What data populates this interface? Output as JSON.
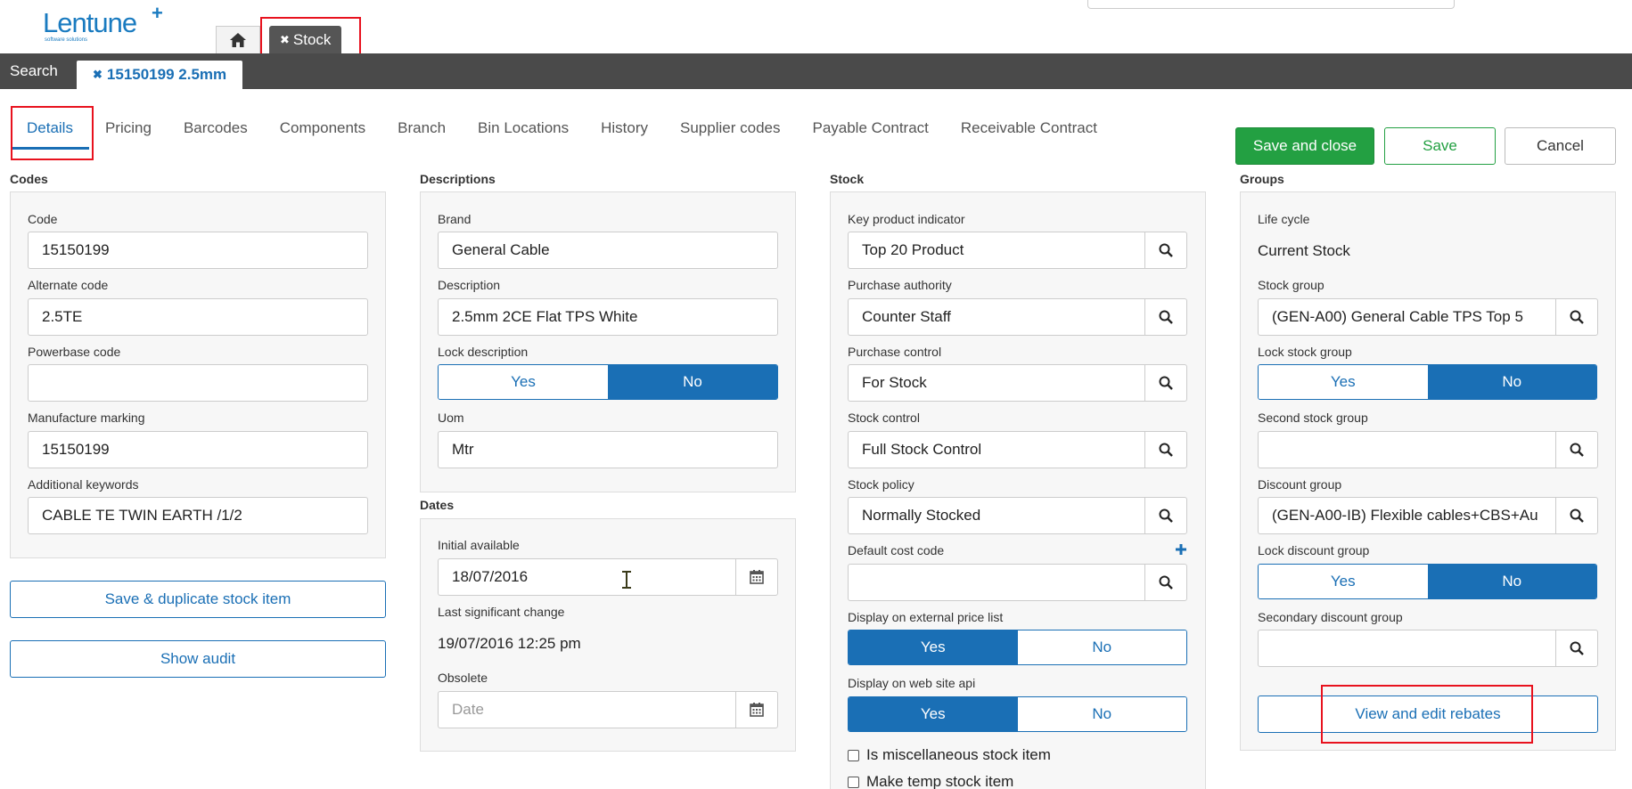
{
  "app": {
    "logo_text": "Lentune",
    "logo_plus": "+",
    "logo_tagline": "software solutions",
    "top_tab_stock": "Stock",
    "doc_bar_search": "Search",
    "doc_tab": "15150199 2.5mm",
    "close_glyph": "✖"
  },
  "tabs": [
    "Details",
    "Pricing",
    "Barcodes",
    "Components",
    "Branch",
    "Bin Locations",
    "History",
    "Supplier codes",
    "Payable Contract",
    "Receivable Contract"
  ],
  "actions": {
    "save_close": "Save and close",
    "save": "Save",
    "cancel": "Cancel"
  },
  "codes": {
    "title": "Codes",
    "code_label": "Code",
    "code": "15150199",
    "alt_label": "Alternate code",
    "alt": "2.5TE",
    "powerbase_label": "Powerbase code",
    "powerbase": "",
    "manuf_label": "Manufacture marking",
    "manuf": "15150199",
    "keywords_label": "Additional keywords",
    "keywords": "CABLE TE TWIN EARTH /1/2",
    "duplicate_button": "Save & duplicate stock item",
    "audit_button": "Show audit"
  },
  "descriptions": {
    "title": "Descriptions",
    "brand_label": "Brand",
    "brand": "General Cable",
    "desc_label": "Description",
    "desc": "2.5mm 2CE Flat TPS White",
    "lock_label": "Lock description",
    "lock_yes": "Yes",
    "lock_no": "No",
    "uom_label": "Uom",
    "uom": "Mtr"
  },
  "dates": {
    "title": "Dates",
    "initial_label": "Initial available",
    "initial": "18/07/2016",
    "last_change_label": "Last significant change",
    "last_change": "19/07/2016 12:25 pm",
    "obsolete_label": "Obsolete",
    "obsolete_placeholder": "Date"
  },
  "stock": {
    "title": "Stock",
    "kpi_label": "Key product indicator",
    "kpi": "Top 20 Product",
    "authority_label": "Purchase authority",
    "authority": "Counter Staff",
    "pcontrol_label": "Purchase control",
    "pcontrol": "For Stock",
    "scontrol_label": "Stock control",
    "scontrol": "Full Stock Control",
    "policy_label": "Stock policy",
    "policy": "Normally Stocked",
    "costcode_label": "Default cost code",
    "costcode": "",
    "ext_label": "Display on external price list",
    "ext_yes": "Yes",
    "ext_no": "No",
    "web_label": "Display on web site api",
    "web_yes": "Yes",
    "web_no": "No",
    "misc_label": "Is miscellaneous stock item",
    "temp_label": "Make temp stock item"
  },
  "groups": {
    "title": "Groups",
    "lifecycle_label": "Life cycle",
    "lifecycle": "Current Stock",
    "sgroup_label": "Stock group",
    "sgroup": "(GEN-A00) General Cable TPS Top 5",
    "lock_sgroup_label": "Lock stock group",
    "lock_sgroup_yes": "Yes",
    "lock_sgroup_no": "No",
    "second_label": "Second stock group",
    "second": "",
    "discount_label": "Discount group",
    "discount": "(GEN-A00-IB) Flexible cables+CBS+Au",
    "lock_discount_label": "Lock discount group",
    "lock_discount_yes": "Yes",
    "lock_discount_no": "No",
    "secdisc_label": "Secondary discount group",
    "secdisc": "",
    "rebates_button": "View and edit rebates"
  },
  "icons": {
    "home": "home-icon",
    "search": "search-icon",
    "calendar": "calendar-icon",
    "plus": "plus-icon",
    "cursor": "text-cursor-icon"
  },
  "colors": {
    "brand": "#1a7bc0",
    "primary": "#1a6fb5",
    "success": "#23a042",
    "dark_bar": "#4a4a4a",
    "highlight": "#e8121e"
  }
}
